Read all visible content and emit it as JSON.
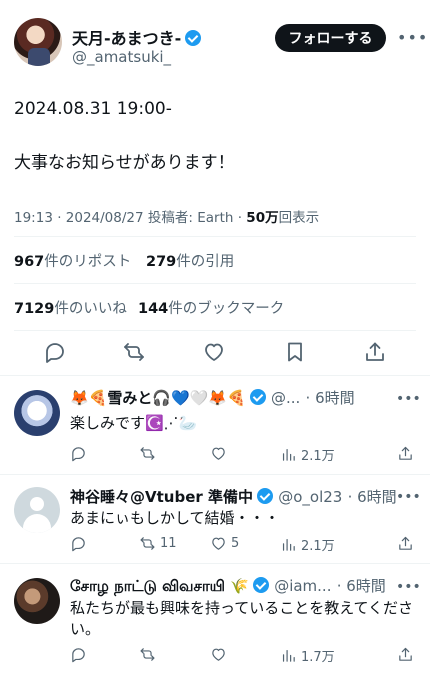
{
  "tweet": {
    "author_name": "天月-あまつき-",
    "author_handle": "@_amatsuki_",
    "follow_label": "フォローする",
    "more": "•••",
    "line1": "2024.08.31 19:00-",
    "line2": "大事なお知らせがあります！",
    "time": "19:13 · 2024/08/27 投稿者: Earth · ",
    "views_count": "50万",
    "views_label": "回表示",
    "reposts_count": "967",
    "reposts_label": "件のリポスト",
    "quotes_count": "279",
    "quotes_label": "件の引用",
    "likes_count": "7129",
    "likes_label": "件のいいね",
    "bookmarks_count": "144",
    "bookmarks_label": "件のブックマーク",
    "verified_color": "#1d9bf0"
  },
  "replies": [
    {
      "name": "🦊🍕雪みと🎧💙🤍🦊🍕",
      "handle": "@...",
      "time": "· 6時間",
      "text": "楽しみです☪️⋰🦢",
      "reply_count": "",
      "repost_count": "",
      "like_count": "",
      "views": "2.1万"
    },
    {
      "name": "神谷睡々@Vtuber 準備中",
      "handle": "@o_ol23",
      "time": "· 6時間",
      "text": "あまにぃもしかして結婚・・・",
      "reply_count": "",
      "repost_count": "11",
      "like_count": "5",
      "views": "2.1万"
    },
    {
      "name": "சோழ நாட்டு விவசாயி 🌾",
      "handle": "@iam...",
      "time": "· 6時間",
      "text": "私たちが最も興味を持っていることを教えてください。",
      "reply_count": "",
      "repost_count": "",
      "like_count": "",
      "views": "1.7万"
    }
  ],
  "icons": [
    "reply-icon",
    "repost-icon",
    "like-icon",
    "bookmark-icon",
    "share-icon",
    "views-icon",
    "verified-icon"
  ]
}
